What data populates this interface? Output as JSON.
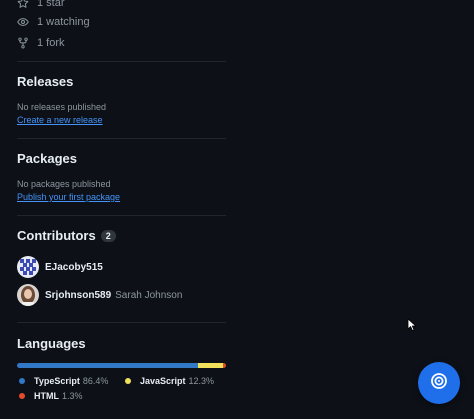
{
  "stats": {
    "stars": "1 star",
    "watching": "1 watching",
    "forks": "1 fork"
  },
  "releases": {
    "title": "Releases",
    "empty_text": "No releases published",
    "create_link": "Create a new release"
  },
  "packages": {
    "title": "Packages",
    "empty_text": "No packages published",
    "publish_link": "Publish your first package"
  },
  "contributors": {
    "title": "Contributors",
    "count": "2",
    "items": [
      {
        "login": "EJacoby515",
        "name": ""
      },
      {
        "login": "Srjohnson589",
        "name": "Sarah Johnson"
      }
    ]
  },
  "languages": {
    "title": "Languages",
    "items": [
      {
        "name": "TypeScript",
        "percent": "86.4%",
        "value": 86.4,
        "color": "#3178c6"
      },
      {
        "name": "JavaScript",
        "percent": "12.3%",
        "value": 12.3,
        "color": "#f1e05a"
      },
      {
        "name": "HTML",
        "percent": "1.3%",
        "value": 1.3,
        "color": "#e34c26"
      }
    ]
  },
  "colors": {
    "background": "#0d1117",
    "link": "#4493f8",
    "fab": "#1f6feb"
  },
  "icons": {
    "star": "star-icon",
    "watch": "eye-icon",
    "fork": "repo-forked-icon",
    "fab": "copilot-target-icon"
  }
}
